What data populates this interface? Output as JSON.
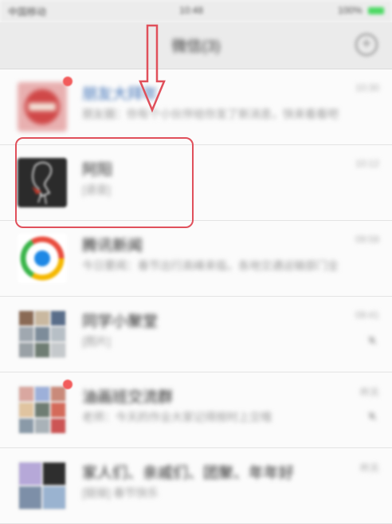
{
  "status_bar": {
    "carrier": "中国移动",
    "time": "10:48",
    "battery": "100%"
  },
  "nav": {
    "title": "微信(3)"
  },
  "chats": [
    {
      "name": "朋友大拜年",
      "preview": "朋友圈：你有个小伙伴给你发了新消息，快来看看吧",
      "time": "10:30"
    },
    {
      "name": "阿阳",
      "preview": "[语音]",
      "time": "10:12"
    },
    {
      "name": "腾讯新闻",
      "preview": "今日要闻：春节出行高峰来临，各地交通运输部门全力保障",
      "time": "09:58"
    },
    {
      "name": "同学小聚堂",
      "preview": "[图片]",
      "time": "09:41"
    },
    {
      "name": "油画班交流群",
      "preview": "老师：今天的作业大家记得按时上交哦",
      "time": "昨天"
    },
    {
      "name": "家人们、亲戚们、团聚、年年好",
      "preview": "[链接] 春节快乐",
      "time": "昨天"
    }
  ],
  "colors": {
    "highlight": "#e0505b",
    "unread": "#f25b5b",
    "accent": "#4cd964"
  }
}
